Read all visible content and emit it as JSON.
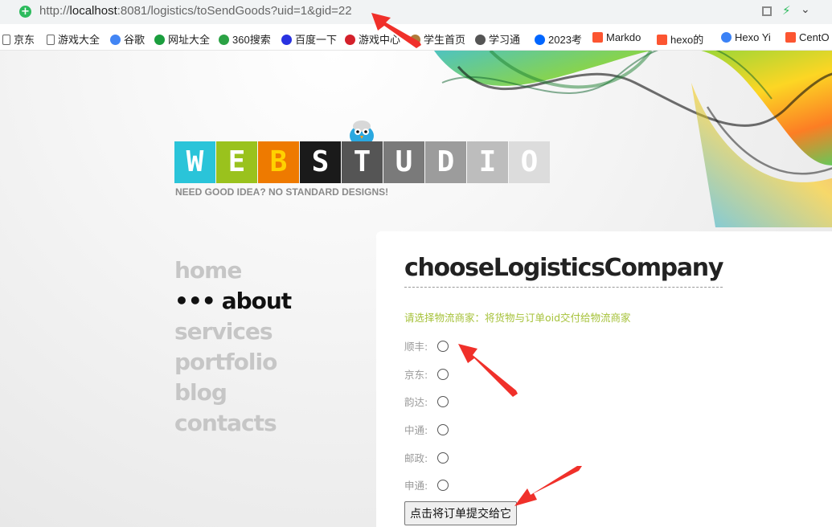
{
  "browser": {
    "url_prefix": "http://",
    "url_host": "localhost",
    "url_rest": ":8081/logistics/toSendGoods?uid=1&gid=22",
    "secure_icon": "plus-shield-icon",
    "bookmarks": [
      {
        "label": "京东",
        "icon": "page-icon",
        "color": "#ffffff"
      },
      {
        "label": "游戏大全",
        "icon": "page-icon",
        "color": "#ffffff"
      },
      {
        "label": "谷歌",
        "icon": "google-icon",
        "color": "#4285f4"
      },
      {
        "label": "网址大全",
        "icon": "plus-icon",
        "color": "#1b9e3e"
      },
      {
        "label": "360搜索",
        "icon": "360-icon",
        "color": "#2ba245"
      },
      {
        "label": "百度一下",
        "icon": "baidu-paw-icon",
        "color": "#2932e1"
      },
      {
        "label": "游戏中心",
        "icon": "game-icon",
        "color": "#d4212b"
      },
      {
        "label": "学生首页",
        "icon": "hands-icon",
        "color": "#b07a3a"
      },
      {
        "label": "学习通",
        "icon": "globe-icon",
        "color": "#555555"
      },
      {
        "label": "2023考",
        "icon": "zhihu-icon",
        "color": "#0066ff"
      },
      {
        "label": "Markdo",
        "icon": "csdn-icon",
        "color": "#fc5531"
      },
      {
        "label": "hexo的",
        "icon": "csdn-icon",
        "color": "#fc5531"
      },
      {
        "label": "Hexo Yi",
        "icon": "hexo-icon",
        "color": "#3b82f6"
      },
      {
        "label": "CentO",
        "icon": "csdn-icon",
        "color": "#fc5531"
      }
    ]
  },
  "site": {
    "logo_letters": [
      "W",
      "E",
      "B",
      "S",
      "T",
      "U",
      "D",
      "I",
      "O"
    ],
    "logo_colors": [
      "#2ac4d9",
      "#9ac21d",
      "#ee7a00",
      "#1a1a1a",
      "#555555",
      "#7a7a7a",
      "#9c9c9c",
      "#bdbdbd",
      "#dcdcdc"
    ],
    "logo_letter_colors": [
      "#ffffff",
      "#ffffff",
      "#ffd100",
      "#ffffff",
      "#ffffff",
      "#ffffff",
      "#ffffff",
      "#ffffff",
      "#ffffff"
    ],
    "tagline": "NEED GOOD IDEA? NO STANDARD DESIGNS!",
    "nav": [
      {
        "label": "home",
        "active": false
      },
      {
        "label": "about",
        "active": true
      },
      {
        "label": "services",
        "active": false
      },
      {
        "label": "portfolio",
        "active": false
      },
      {
        "label": "blog",
        "active": false
      },
      {
        "label": "contacts",
        "active": false
      }
    ],
    "active_marker": "•••"
  },
  "content": {
    "title": "chooseLogisticsCompany",
    "hint": "请选择物流商家：将货物与订单oid交付给物流商家",
    "options": [
      "顺丰:",
      "京东:",
      "韵达:",
      "中通:",
      "邮政:",
      "申通:"
    ],
    "submit_label": "点击将订单提交给它",
    "accent_color": "#a6c23a"
  }
}
